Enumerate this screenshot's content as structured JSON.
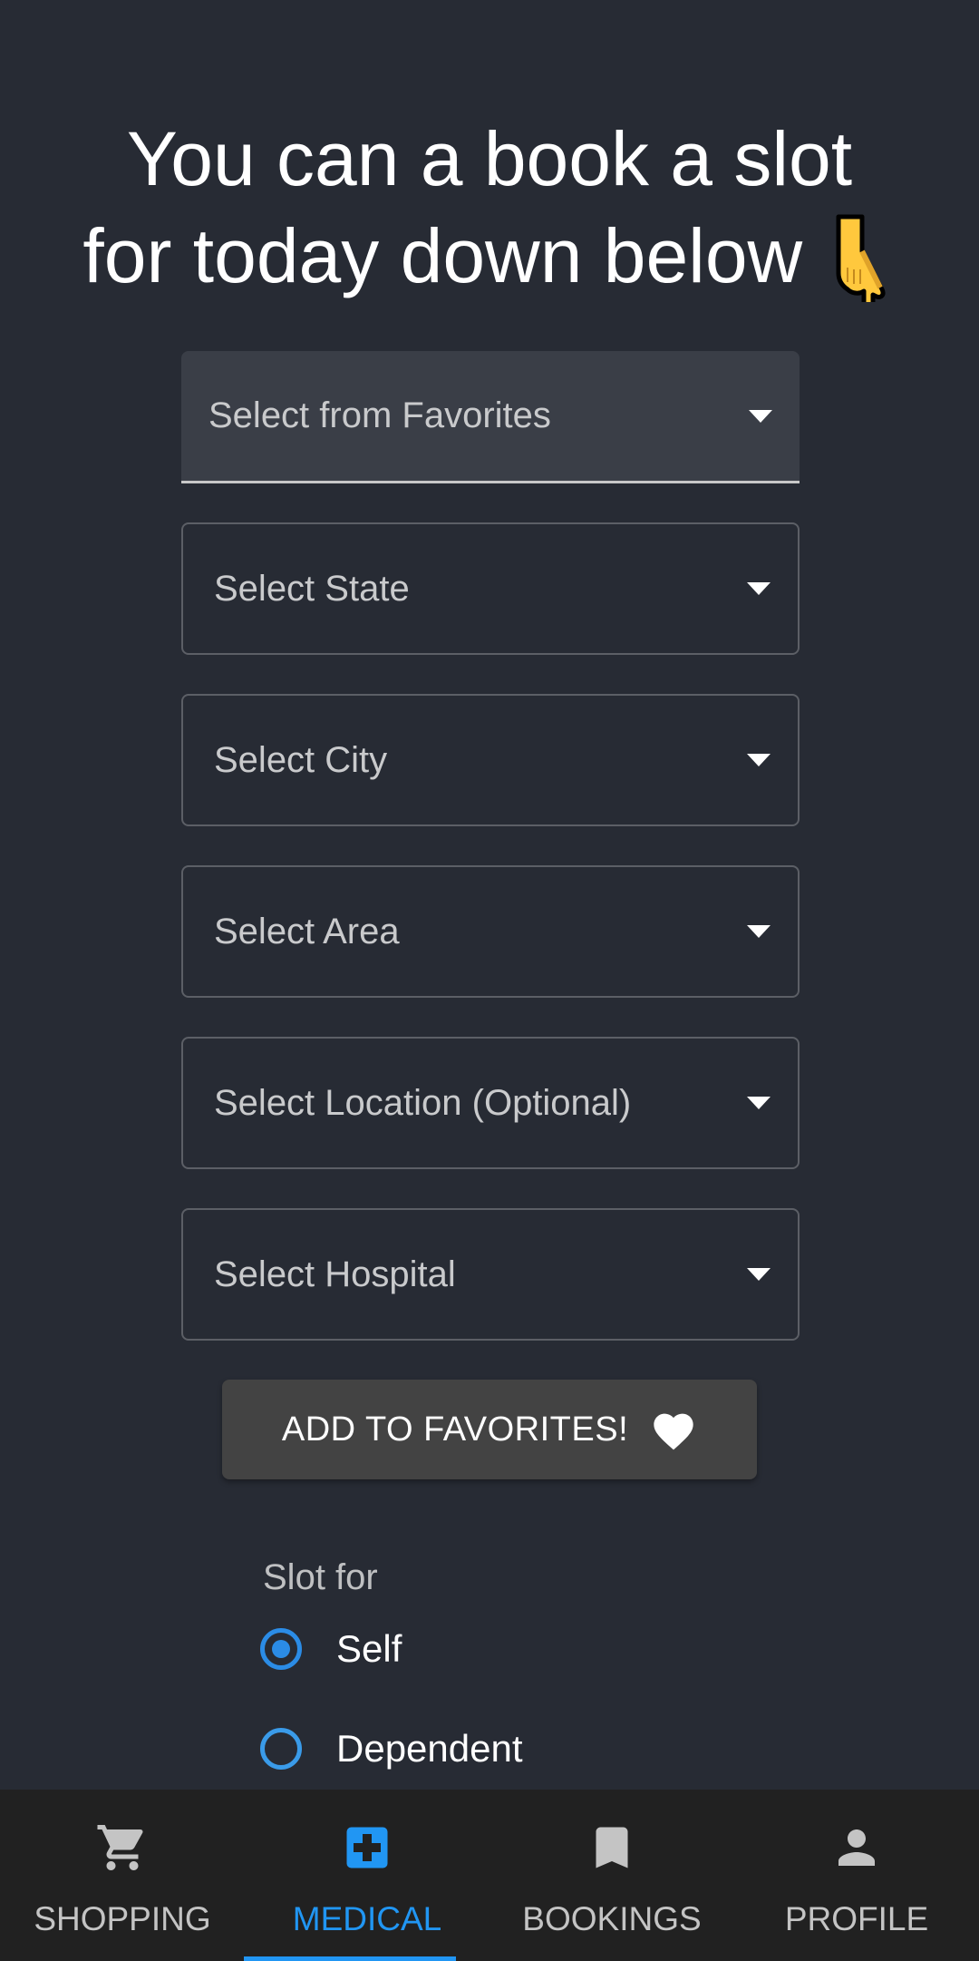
{
  "headline": {
    "line1": "You can a book a slot",
    "line2": "for today down below",
    "emoji": "backhand-index-pointing-down"
  },
  "fields": [
    {
      "label": "Select from Favorites",
      "variant": "filled"
    },
    {
      "label": "Select State",
      "variant": "outlined"
    },
    {
      "label": "Select City",
      "variant": "outlined"
    },
    {
      "label": "Select Area",
      "variant": "outlined"
    },
    {
      "label": "Select Location (Optional)",
      "variant": "outlined"
    },
    {
      "label": "Select Hospital",
      "variant": "outlined"
    }
  ],
  "favorites_button": {
    "label": "ADD TO FAVORITES!",
    "icon": "heart-icon"
  },
  "slot_for": {
    "label": "Slot for",
    "options": [
      {
        "label": "Self",
        "checked": true
      },
      {
        "label": "Dependent",
        "checked": false
      }
    ]
  },
  "colors": {
    "accent": "#2196f3",
    "background": "#272b34",
    "nav_background": "#212121"
  },
  "bottom_nav": {
    "items": [
      {
        "label": "SHOPPING",
        "icon": "cart-icon",
        "active": false
      },
      {
        "label": "MEDICAL",
        "icon": "medical-cross-icon",
        "active": true
      },
      {
        "label": "BOOKINGS",
        "icon": "bookmark-icon",
        "active": false
      },
      {
        "label": "PROFILE",
        "icon": "person-icon",
        "active": false
      }
    ]
  }
}
